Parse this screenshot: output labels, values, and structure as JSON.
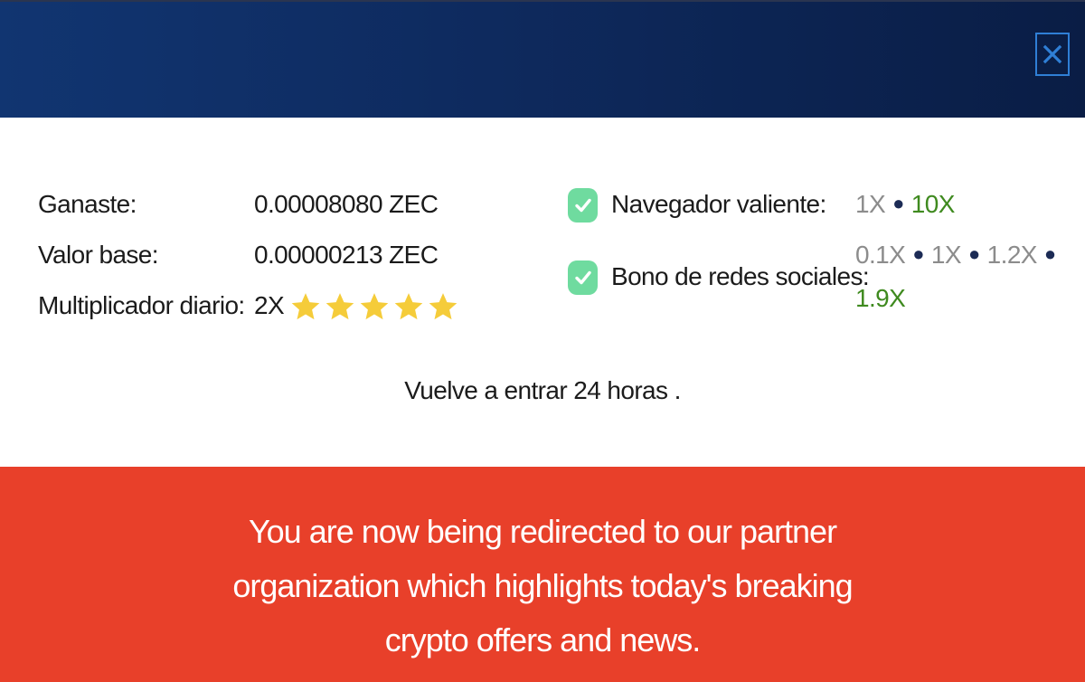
{
  "header": {
    "close_label": "×"
  },
  "stats": {
    "earned_label": "Ganaste:",
    "earned_value": "0.00008080 ZEC",
    "base_label": "Valor base:",
    "base_value": "0.00000213 ZEC",
    "daily_label": "Multiplicador diario:",
    "daily_value": "2X",
    "daily_stars": 5
  },
  "bonuses": [
    {
      "label": "Navegador valiente:",
      "checked": true,
      "multipliers": [
        "1X",
        "10X"
      ],
      "active": "10X"
    },
    {
      "label": "Bono de redes sociales:",
      "checked": true,
      "multipliers": [
        "0.1X",
        "1X",
        "1.2X",
        "1.9X"
      ],
      "active": "1.9X"
    }
  ],
  "return_message": "Vuelve a entrar 24 horas .",
  "banner": {
    "text": "You are now being redirected to our partner organization which highlights today's breaking crypto offers and news."
  },
  "colors": {
    "header_bg": "#0e2a5e",
    "banner_bg": "#e8402a",
    "check_bg": "#6fdb9f",
    "star": "#f5cc3a",
    "active_multiplier": "#3f8a1f",
    "inactive_multiplier": "#8c8c8c"
  }
}
